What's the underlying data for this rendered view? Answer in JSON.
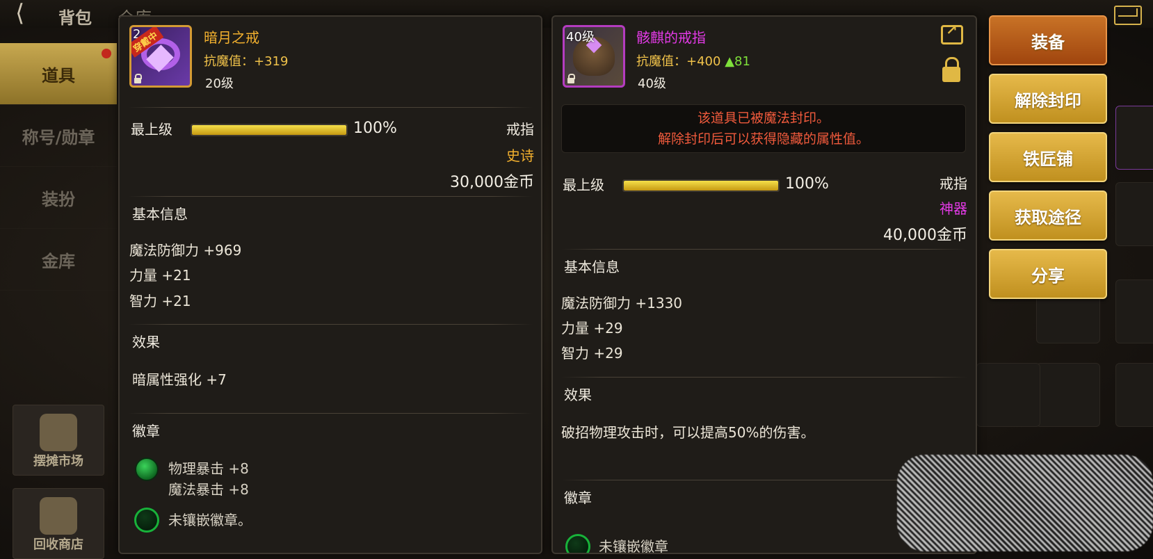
{
  "top": {
    "title": "背包",
    "tab2": "仓库"
  },
  "sidebar": {
    "items": [
      {
        "label": "道具",
        "active": true
      },
      {
        "label": "称号/勋章",
        "active": false
      },
      {
        "label": "装扮",
        "active": false
      },
      {
        "label": "金库",
        "active": false
      }
    ],
    "tiles": [
      {
        "label": "摆摊市场"
      },
      {
        "label": "回收商店"
      }
    ]
  },
  "left_item": {
    "name": "暗月之戒",
    "wearing_tag": "穿戴中",
    "icon_level": "2",
    "resist_label": "抗魔值：",
    "resist_value": "+319",
    "level": "20级",
    "upgrade_label": "最上级",
    "upgrade_percent": "100%",
    "upgrade_fraction": 1.0,
    "type": "戒指",
    "rarity": "史诗",
    "price": "30,000金币",
    "basic_title": "基本信息",
    "stats": [
      "魔法防御力 +969",
      "力量 +21",
      "智力 +21"
    ],
    "effect_title": "效果",
    "effects": [
      "暗属性强化 +7"
    ],
    "badge_title": "徽章",
    "badges": [
      {
        "lines": [
          "物理暴击 +8",
          "魔法暴击 +8"
        ],
        "filled": true
      },
      {
        "lines": [
          "未镶嵌徽章。"
        ],
        "filled": false
      }
    ]
  },
  "right_item": {
    "name": "骸麒的戒指",
    "icon_level": "40级",
    "resist_label": "抗魔值：",
    "resist_value": "+400",
    "resist_delta": "▲81",
    "level": "40级",
    "sealed_line1": "该道具已被魔法封印。",
    "sealed_line2": "解除封印后可以获得隐藏的属性值。",
    "upgrade_label": "最上级",
    "upgrade_percent": "100%",
    "upgrade_fraction": 1.0,
    "type": "戒指",
    "rarity": "神器",
    "price": "40,000金币",
    "basic_title": "基本信息",
    "stats": [
      "魔法防御力 +1330",
      "力量 +29",
      "智力 +29"
    ],
    "effect_title": "效果",
    "effects": [
      "破招物理攻击时，可以提高50%的伤害。"
    ],
    "badge_title": "徽章",
    "badge_partial": "未镶嵌徽章"
  },
  "actions": [
    "装备",
    "解除封印",
    "铁匠铺",
    "获取途径",
    "分享"
  ],
  "colors": {
    "epic": "#f2b02e",
    "artifact": "#e33ae6",
    "sealed": "#f05a3c",
    "delta": "#7ee03a",
    "button": "#d4a63a"
  }
}
